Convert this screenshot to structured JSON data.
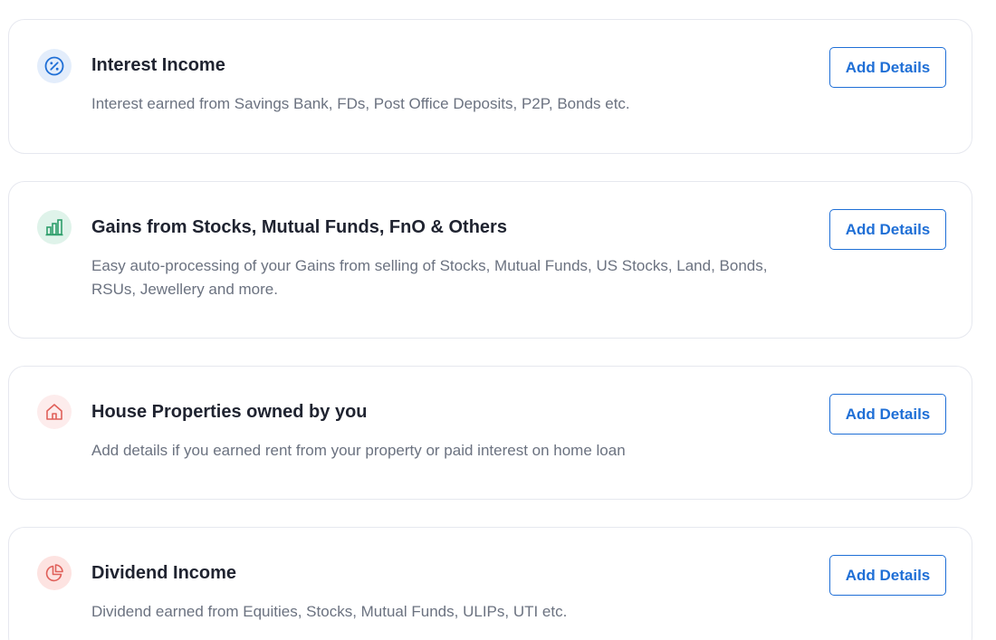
{
  "income_sources": [
    {
      "icon": "percent-icon",
      "title": "Interest Income",
      "description": "Interest earned from Savings Bank, FDs, Post Office Deposits, P2P, Bonds etc.",
      "button_label": "Add Details"
    },
    {
      "icon": "bar-chart-icon",
      "title": "Gains from Stocks, Mutual Funds, FnO & Others",
      "description": "Easy auto-processing of your Gains from selling of Stocks, Mutual Funds, US Stocks, Land, Bonds, RSUs, Jewellery and more.",
      "button_label": "Add Details"
    },
    {
      "icon": "house-icon",
      "title": "House Properties owned by you",
      "description": "Add details if you earned rent from your property or paid interest on home loan",
      "button_label": "Add Details"
    },
    {
      "icon": "pie-chart-icon",
      "title": "Dividend Income",
      "description": "Dividend earned from Equities, Stocks, Mutual Funds, ULIPs, UTI etc.",
      "button_label": "Add Details"
    }
  ],
  "colors": {
    "accent": "#1f6fd6",
    "interest_icon_bg": "#e3edfb",
    "gains_icon_bg": "#dff3ea",
    "house_icon_bg": "#fdecec",
    "dividend_icon_bg": "#fde3e1"
  }
}
